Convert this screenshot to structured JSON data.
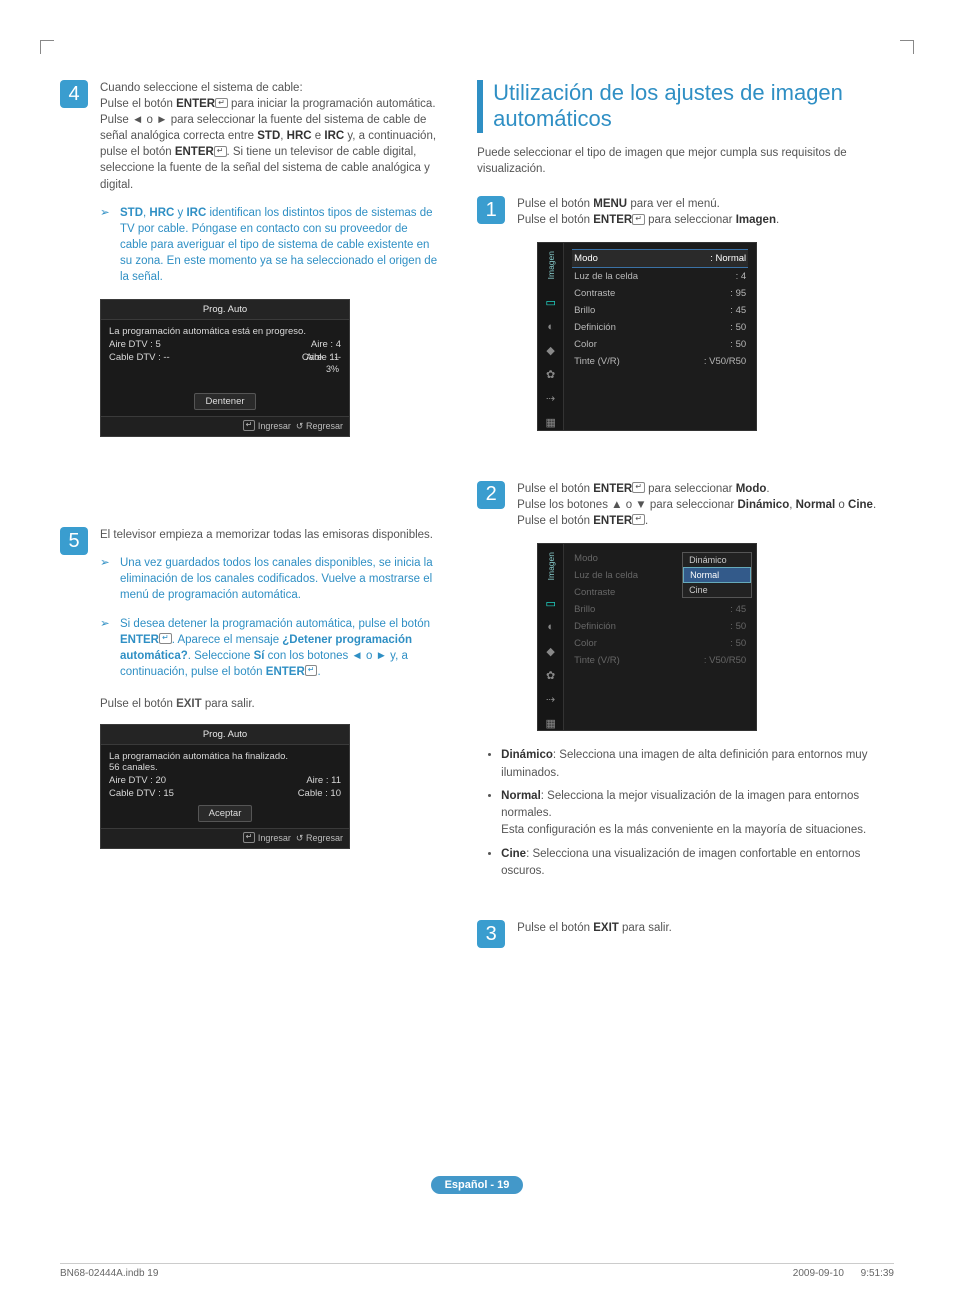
{
  "left": {
    "step4": {
      "num": "4",
      "l1": "Cuando seleccione el sistema de cable:",
      "l2a": "Pulse el botón ",
      "l2b": "ENTER",
      "l2c": " para iniciar la programación automática.",
      "l3a": "Pulse ◄ o ► para seleccionar la fuente del sistema de cable de señal analógica correcta entre ",
      "l3b": "STD",
      "l3c": ", ",
      "l3d": "HRC",
      "l3e": " e ",
      "l3f": "IRC",
      "l3g": " y, a continuación, pulse el botón ",
      "l3h": "ENTER",
      "l3i": ". Si tiene un televisor de cable digital, seleccione la fuente de la señal del sistema de cable analógica y digital.",
      "note1a": "STD",
      "note1b": ", ",
      "note1c": "HRC",
      "note1d": " y ",
      "note1e": "IRC",
      "note1f": " identifican los distintos tipos de sistemas de TV por cable. Póngase en contacto con su proveedor de cable para averiguar el tipo de sistema de cable existente en su zona. En este momento ya se ha seleccionado el origen de la señal."
    },
    "panel1": {
      "title": "Prog. Auto",
      "msg": "La programación automática está en progreso.",
      "r1l": "Aire DTV : 5",
      "r1r": "Aire : 4",
      "r2l": "Cable DTV : --",
      "r2r": "Cable : --",
      "sublabel": "Aire",
      "subv1": "11",
      "subv2": "3%",
      "btn": "Dentener",
      "footer_enter": "Ingresar",
      "footer_return": "Regresar"
    },
    "step5": {
      "num": "5",
      "l1": "El televisor empieza a memorizar todas las emisoras disponibles.",
      "note1": "Una vez guardados todos los canales disponibles, se inicia la eliminación de los canales codificados. Vuelve a mostrarse el menú de programación automática.",
      "note2a": "Si desea detener la programación automática, pulse el botón ",
      "note2b": "ENTER",
      "note2c": ". Aparece el mensaje ",
      "note2d": "¿Detener programación automática?",
      "note2e": ". Seleccione ",
      "note2f": "Sí",
      "note2g": " con los botones ◄ o ► y, a continuación, pulse el botón ",
      "note2h": "ENTER",
      "note2i": "."
    },
    "exitline_a": "Pulse el botón ",
    "exitline_b": "EXIT",
    "exitline_c": " para salir.",
    "panel2": {
      "title": "Prog. Auto",
      "msg": "La programación automática ha finalizado.",
      "ch": "56 canales.",
      "r1l": "Aire DTV : 20",
      "r1r": "Aire : 11",
      "r2l": "Cable DTV : 15",
      "r2r": "Cable : 10",
      "btn": "Aceptar",
      "footer_enter": "Ingresar",
      "footer_return": "Regresar"
    }
  },
  "right": {
    "title": "Utilización de los ajustes de imagen automáticos",
    "intro": "Puede seleccionar el tipo de imagen que mejor cumpla sus requisitos de visualización.",
    "sidebar_label": "Imagen",
    "step1": {
      "num": "1",
      "l1a": "Pulse el botón ",
      "l1b": "MENU",
      "l1c": " para ver el menú.",
      "l2a": "Pulse el botón ",
      "l2b": "ENTER",
      "l2c": " para seleccionar ",
      "l2d": "Imagen",
      "l2e": "."
    },
    "menu1": {
      "r1k": "Modo",
      "r1v": ": Normal",
      "r2k": "Luz de la celda",
      "r2v": ": 4",
      "r3k": "Contraste",
      "r3v": ": 95",
      "r4k": "Brillo",
      "r4v": ": 45",
      "r5k": "Definición",
      "r5v": ": 50",
      "r6k": "Color",
      "r6v": ": 50",
      "r7k": "Tinte (V/R)",
      "r7v": ": V50/R50"
    },
    "step2": {
      "num": "2",
      "l1a": "Pulse el botón ",
      "l1b": "ENTER",
      "l1c": " para seleccionar ",
      "l1d": "Modo",
      "l1e": ".",
      "l2a": "Pulse los botones ▲ o ▼ para seleccionar ",
      "l2b": "Dinámico",
      "l2c": ", ",
      "l2d": "Normal",
      "l2e": " o ",
      "l2f": "Cine",
      "l2g": ".",
      "l3a": "Pulse el botón ",
      "l3b": "ENTER",
      "l3c": "."
    },
    "menu2": {
      "r1k": "Modo",
      "r2k": "Luz de la celda",
      "r3k": "Contraste",
      "r4k": "Brillo",
      "r4v": ": 45",
      "r5k": "Definición",
      "r5v": ": 50",
      "r6k": "Color",
      "r6v": ": 50",
      "r7k": "Tinte (V/R)",
      "r7v": ": V50/R50",
      "dd1": "Dinámico",
      "dd2": "Normal",
      "dd3": "Cine"
    },
    "bullets": {
      "b1a": "Dinámico",
      "b1b": ": Selecciona una imagen de alta definición para entornos muy iluminados.",
      "b2a": "Normal",
      "b2b": ": Selecciona la mejor visualización de la imagen para entornos normales.",
      "b2c": "Esta configuración es la más conveniente en la mayoría de situaciones.",
      "b3a": "Cine",
      "b3b": ":  Selecciona una visualización de imagen confortable en entornos oscuros."
    },
    "step3": {
      "num": "3",
      "l1a": "Pulse el botón ",
      "l1b": "EXIT",
      "l1c": " para salir."
    }
  },
  "page_badge": "Español - 19",
  "footer_left": "BN68-02444A.indb   19",
  "footer_right": "2009-09-10      9:51:39",
  "icons": {
    "enter": "↵",
    "return": "↺"
  }
}
